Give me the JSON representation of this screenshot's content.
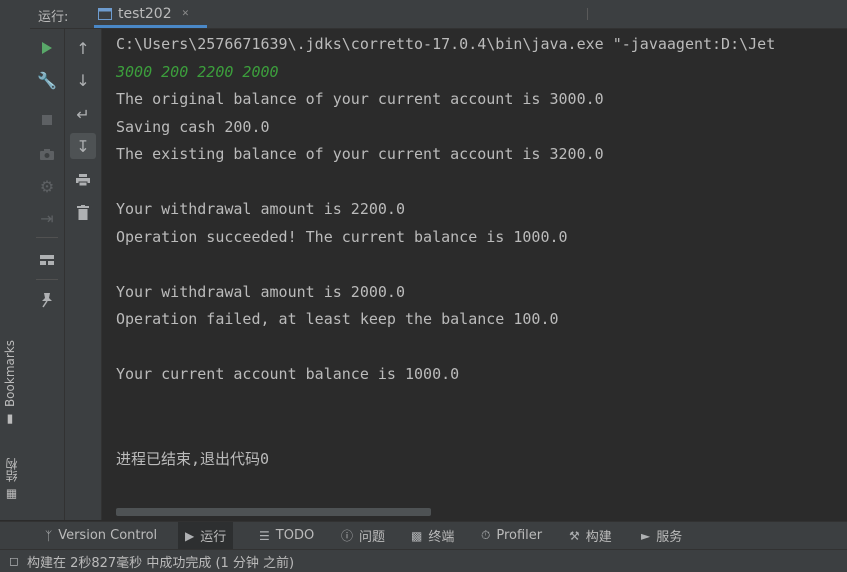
{
  "topbar": {
    "run_label": "运行:",
    "tab_title": "test202"
  },
  "sidebar": {
    "bookmarks_label": "Bookmarks",
    "structure_label": "结构"
  },
  "console": {
    "lines": [
      "C:\\Users\\2576671639\\.jdks\\corretto-17.0.4\\bin\\java.exe \"-javaagent:D:\\Jet",
      "3000 200 2200 2000",
      "The original balance of your current account is 3000.0",
      "Saving cash 200.0",
      "The existing balance of your current account is 3200.0",
      "Your withdrawal amount is 2200.0",
      "Operation succeeded! The current balance is 1000.0",
      "Your withdrawal amount is 2000.0",
      "Operation failed, at least keep the balance 100.0",
      "Your current account balance is 1000.0",
      "进程已结束,退出代码0"
    ]
  },
  "bottom_tabs": [
    {
      "label": "Version Control",
      "icon": "branch-icon"
    },
    {
      "label": "运行",
      "icon": "run-icon"
    },
    {
      "label": "TODO",
      "icon": "list-icon"
    },
    {
      "label": "问题",
      "icon": "info-icon"
    },
    {
      "label": "终端",
      "icon": "terminal-icon"
    },
    {
      "label": "Profiler",
      "icon": "profiler-icon"
    },
    {
      "label": "构建",
      "icon": "hammer-icon"
    },
    {
      "label": "服务",
      "icon": "services-icon"
    }
  ],
  "status": {
    "text": "构建在 2秒827毫秒 中成功完成 (1 分钟 之前)"
  },
  "colors": {
    "background": "#2b2b2b",
    "panel": "#3c3f41",
    "accent_tab": "#4a88c7",
    "input_text": "#3c9e3c",
    "run_green": "#59a869",
    "pin_red": "#c75450"
  }
}
